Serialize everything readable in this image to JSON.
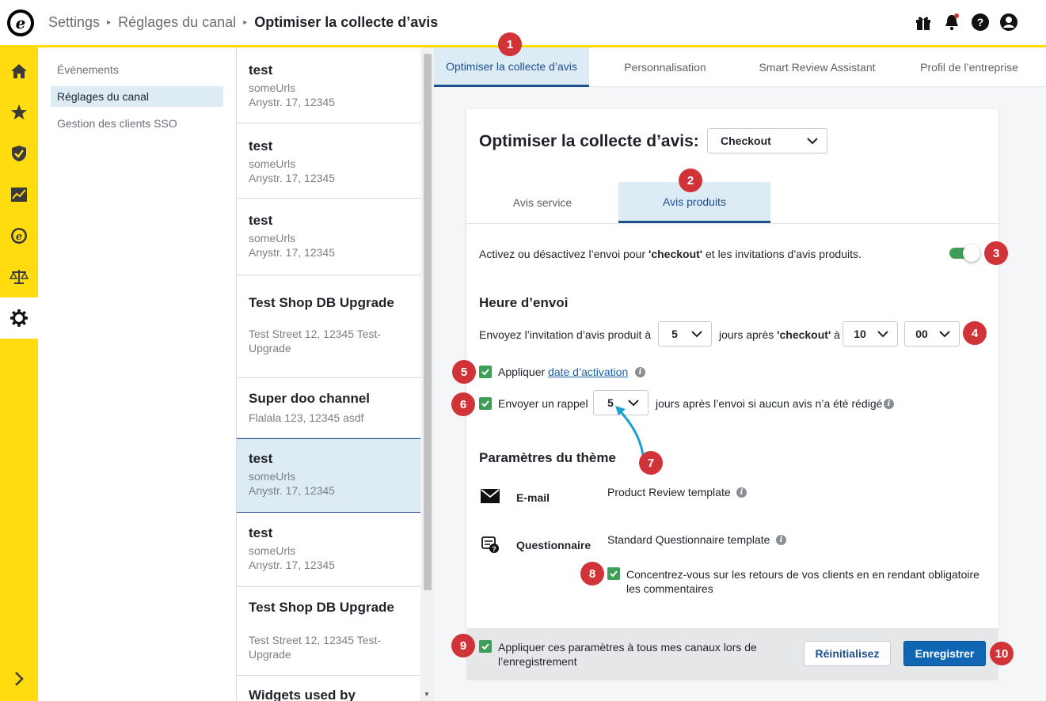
{
  "header": {
    "breadcrumbs": [
      "Settings",
      "Réglages du canal",
      "Optimiser la collecte d’avis"
    ]
  },
  "rail": {
    "icons": [
      "home-icon",
      "star-icon",
      "shield-icon",
      "analytics-icon",
      "trusted-logo-icon",
      "scales-icon",
      "gear-icon"
    ],
    "accent": "#ffdc0f"
  },
  "subnav": {
    "items": [
      "Événements",
      "Réglages du canal",
      "Gestion des clients SSO"
    ],
    "active": "Réglages du canal"
  },
  "channels": [
    {
      "title": "test",
      "line1": "someUrls",
      "line2": "Anystr. 17, 12345"
    },
    {
      "title": "test",
      "line1": "someUrls",
      "line2": "Anystr. 17, 12345"
    },
    {
      "title": "test",
      "line1": "someUrls",
      "line2": "Anystr. 17, 12345"
    },
    {
      "title": "Test Shop DB Upgrade",
      "line1": "Test Street 12, 12345 Test-",
      "line2": "Upgrade"
    },
    {
      "title": "Super doo channel",
      "line1": "Flalala 123, 12345 asdf",
      "line2": ""
    },
    {
      "title": "test",
      "line1": "someUrls",
      "line2": "Anystr. 17, 12345"
    },
    {
      "title": "test",
      "line1": "someUrls",
      "line2": "Anystr. 17, 12345"
    },
    {
      "title": "Test Shop DB Upgrade",
      "line1": "Test Street 12, 12345 Test-",
      "line2": "Upgrade"
    },
    {
      "title": "Widgets used by",
      "line1": "",
      "line2": ""
    }
  ],
  "tabs": [
    "Optimiser la collecte d’avis",
    "Personnalisation",
    "Smart Review Assistant",
    "Profil de l’entreprise"
  ],
  "card": {
    "title": "Optimiser la collecte d’avis:",
    "mode_select": "Checkout",
    "subtabs": [
      "Avis service",
      "Avis produits"
    ],
    "toggle_text_pre": "Activez ou désactivez l’envoi pour ",
    "toggle_text_bold": "'checkout'",
    "toggle_text_post": " et les invitations d’avis produits.",
    "toggle_on": true,
    "send_time_heading": "Heure d’envoi",
    "send_pre": "Envoyez l’invitation d’avis produit à",
    "days_value": "5",
    "send_mid_pre": "jours après ",
    "send_mid_bold": "'checkout'",
    "send_mid_post": " à",
    "hour_value": "10",
    "minute_value": "00",
    "activation_pre": "Appliquer ",
    "activation_link": "date d’activation",
    "reminder_label": "Envoyer un rappel",
    "reminder_value": "5",
    "reminder_post": "jours après l’envoi si aucun avis n’a été rédigé",
    "theme_heading": "Paramètres du thème",
    "email_label": "E-mail",
    "email_template": "Product Review template",
    "questionnaire_label": "Questionnaire",
    "questionnaire_template": "Standard Questionnaire template",
    "mandatory_comments": "Concentrez-vous sur les retours de vos clients en en rendant obligatoire les commentaires"
  },
  "footer": {
    "apply_all": "Appliquer ces paramètres à tous mes canaux lors de l’enregistrement",
    "reset_label": "Réinitialisez",
    "save_label": "Enregistrer"
  },
  "badges": [
    "1",
    "2",
    "3",
    "4",
    "5",
    "6",
    "7",
    "8",
    "9",
    "10"
  ],
  "colors": {
    "badge": "#d13438",
    "primary": "#0f66b3",
    "checkbox": "#3f9d57",
    "active_tab_bg": "#dcebf4"
  }
}
